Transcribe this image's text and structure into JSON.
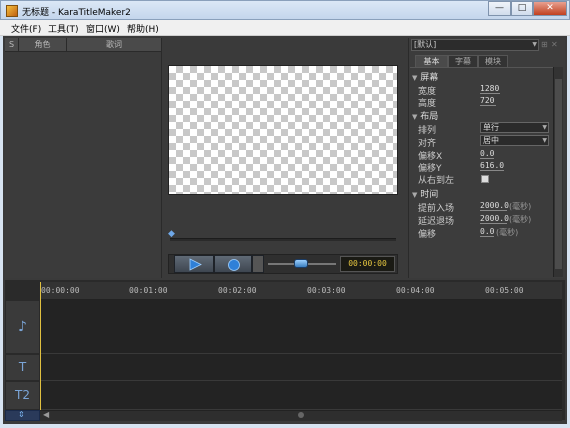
{
  "window": {
    "title": "无标题 - KaraTitleMaker2",
    "minimize": "—",
    "maximize": "□",
    "close": "✕"
  },
  "menu": [
    "文件(F)",
    "工具(T)",
    "窗口(W)",
    "帮助(H)"
  ],
  "lyrics_table": {
    "columns": [
      "S",
      "角色",
      "歌词"
    ]
  },
  "transport": {
    "time": "00:00:00",
    "volume_level": 0.55
  },
  "properties": {
    "preset": "[默认]",
    "tabs": [
      "基本",
      "字幕",
      "模块"
    ],
    "active_tab": 0,
    "sections": {
      "screen": {
        "title": "屏幕",
        "width_label": "宽度",
        "width_value": "1280",
        "height_label": "高度",
        "height_value": "720"
      },
      "layout": {
        "title": "布局",
        "arrange_label": "排列",
        "arrange_value": "单行",
        "align_label": "对齐",
        "align_value": "居中",
        "offset_x_label": "偏移X",
        "offset_x_value": "0.0",
        "offset_y_label": "偏移Y",
        "offset_y_value": "616.0",
        "rtl_label": "从右到左"
      },
      "time": {
        "title": "时间",
        "pre_enter_label": "提前入场",
        "pre_enter_value": "2000.0",
        "delay_exit_label": "延迟退场",
        "delay_exit_value": "2000.0",
        "offset_label": "偏移",
        "offset_value": "0.0",
        "unit": "(毫秒)"
      }
    }
  },
  "timeline": {
    "ticks": [
      "00:00:00",
      "00:01:00",
      "00:02:00",
      "00:03:00",
      "00:04:00",
      "00:05:00"
    ],
    "tracks": [
      "music",
      "T",
      "T2"
    ]
  }
}
